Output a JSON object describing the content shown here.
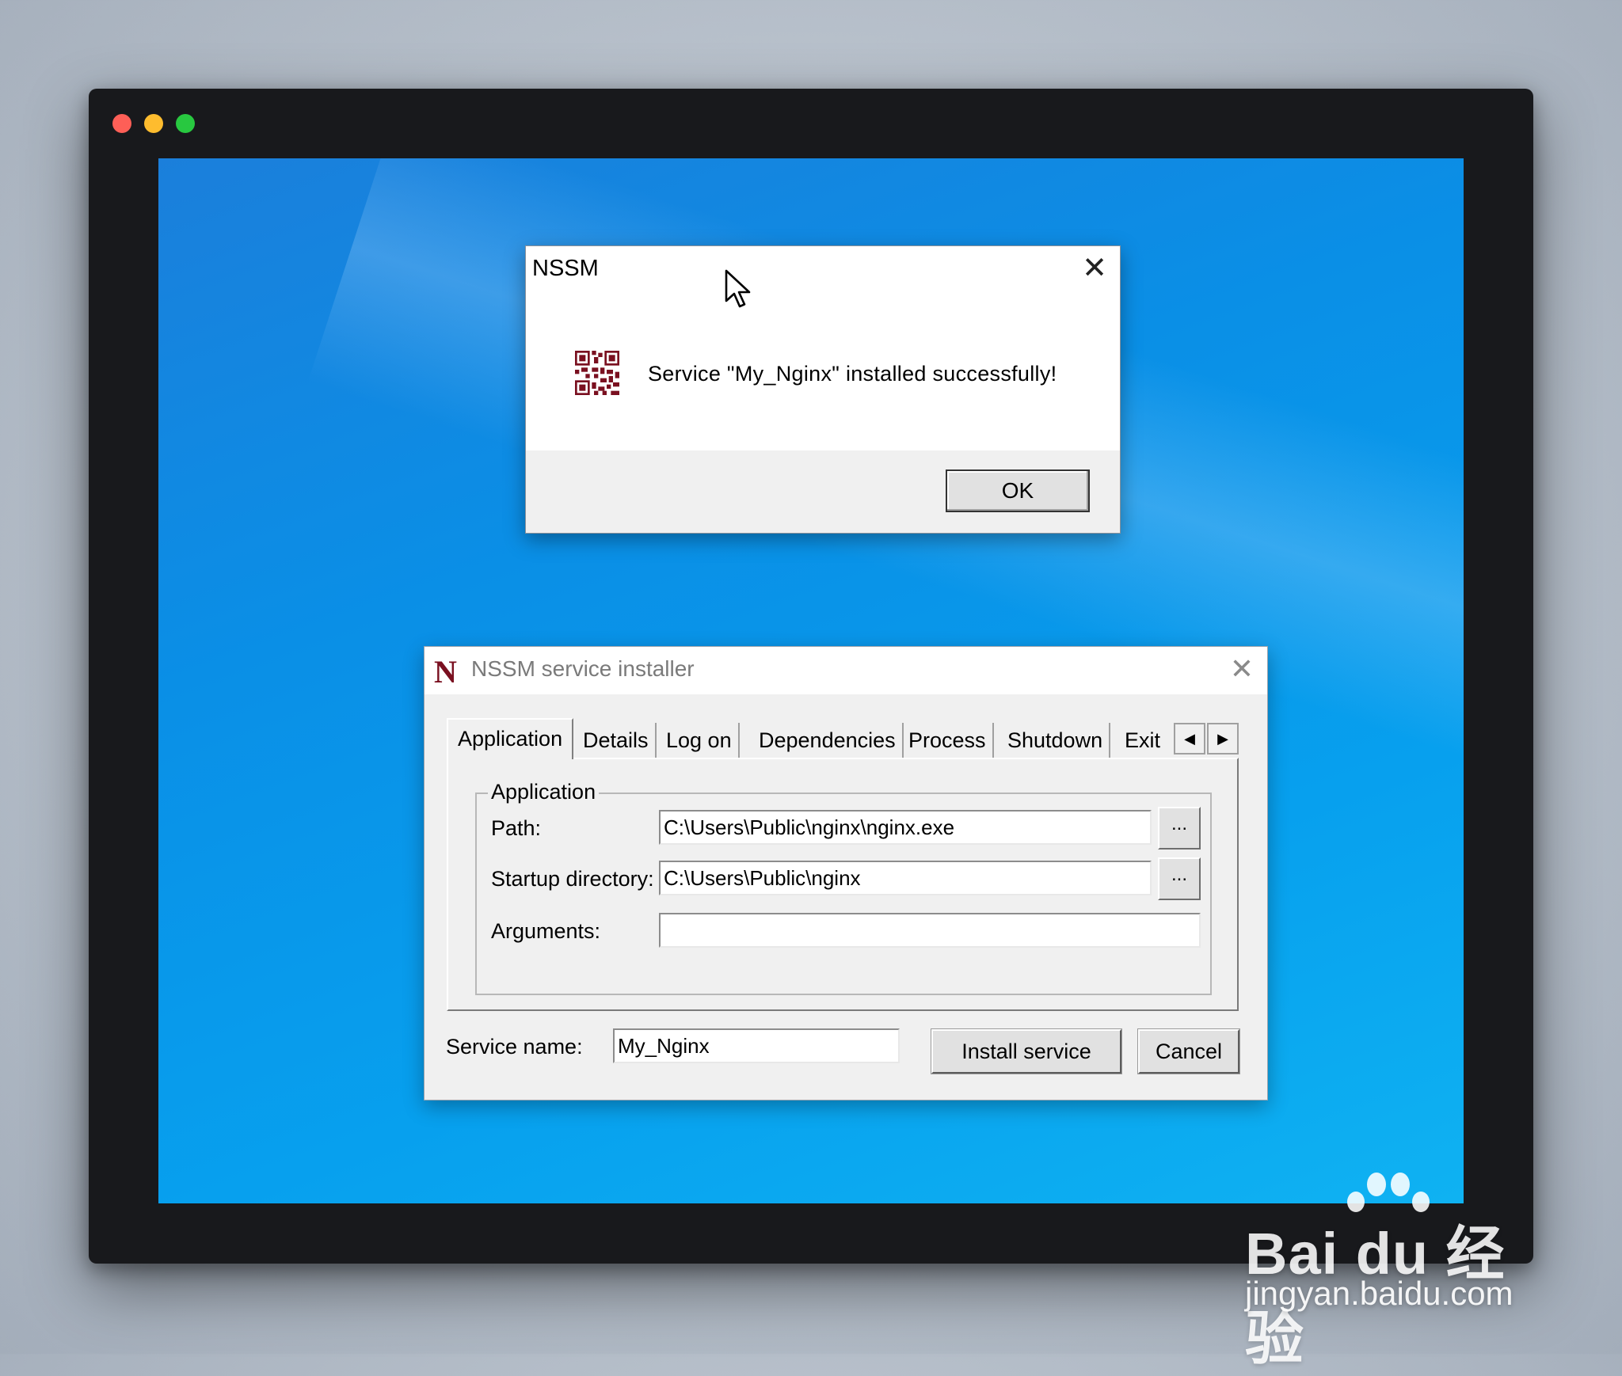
{
  "message_box": {
    "title": "NSSM",
    "close_glyph": "✕",
    "icon": "qr-code-icon",
    "message": "Service \"My_Nginx\" installed successfully!",
    "ok_label": "OK"
  },
  "installer": {
    "app_letter": "N",
    "title": "NSSM service installer",
    "close_glyph": "✕",
    "tabs": [
      "Application",
      "Details",
      "Log on",
      "Dependencies",
      "Process",
      "Shutdown",
      "Exit"
    ],
    "active_tab": "Application",
    "scroll_left_glyph": "◀",
    "scroll_right_glyph": "▶",
    "group_title": "Application",
    "path": {
      "label": "Path:",
      "value": "C:\\Users\\Public\\nginx\\nginx.exe",
      "browse_label": "..."
    },
    "startup_directory": {
      "label": "Startup directory:",
      "value": "C:\\Users\\Public\\nginx",
      "browse_label": "..."
    },
    "arguments": {
      "label": "Arguments:",
      "value": ""
    },
    "service_name": {
      "label": "Service name:",
      "value": "My_Nginx"
    },
    "install_label": "Install service",
    "cancel_label": "Cancel"
  },
  "watermark": {
    "logo": "Bai du 经验",
    "url": "jingyan.baidu.com"
  },
  "colors": {
    "desktop": "#0a8fe6",
    "frame": "#18191c",
    "dialog": "#f0f0f0",
    "app_icon": "#7a1020"
  }
}
